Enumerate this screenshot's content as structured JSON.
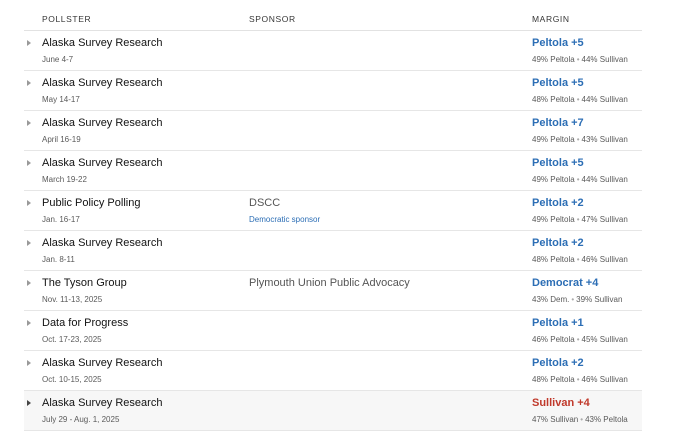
{
  "headers": {
    "pollster": "POLLSTER",
    "sponsor": "SPONSOR",
    "margin": "MARGIN"
  },
  "separator": "•",
  "colors": {
    "dem": "#2c6eb5",
    "rep": "#c0392b"
  },
  "polls": [
    {
      "pollster": "Alaska Survey Research",
      "dates": "June 4-7",
      "sponsor": "",
      "sponsor_note": "",
      "margin": "Peltola +5",
      "left": "49% Peltola",
      "right": "44% Sullivan"
    },
    {
      "pollster": "Alaska Survey Research",
      "dates": "May 14-17",
      "sponsor": "",
      "sponsor_note": "",
      "margin": "Peltola +5",
      "left": "48% Peltola",
      "right": "44% Sullivan"
    },
    {
      "pollster": "Alaska Survey Research",
      "dates": "April 16-19",
      "sponsor": "",
      "sponsor_note": "",
      "margin": "Peltola +7",
      "left": "49% Peltola",
      "right": "43% Sullivan"
    },
    {
      "pollster": "Alaska Survey Research",
      "dates": "March 19-22",
      "sponsor": "",
      "sponsor_note": "",
      "margin": "Peltola +5",
      "left": "49% Peltola",
      "right": "44% Sullivan"
    },
    {
      "pollster": "Public Policy Polling",
      "dates": "Jan. 16-17",
      "sponsor": "DSCC",
      "sponsor_note": "Democratic sponsor",
      "margin": "Peltola +2",
      "left": "49% Peltola",
      "right": "47% Sullivan"
    },
    {
      "pollster": "Alaska Survey Research",
      "dates": "Jan. 8-11",
      "sponsor": "",
      "sponsor_note": "",
      "margin": "Peltola +2",
      "left": "48% Peltola",
      "right": "46% Sullivan"
    },
    {
      "pollster": "The Tyson Group",
      "dates": "Nov. 11-13, 2025",
      "sponsor": "Plymouth Union Public Advocacy",
      "sponsor_note": "",
      "margin": "Democrat +4",
      "left": "43% Dem.",
      "right": "39% Sullivan"
    },
    {
      "pollster": "Data for Progress",
      "dates": "Oct. 17-23, 2025",
      "sponsor": "",
      "sponsor_note": "",
      "margin": "Peltola +1",
      "left": "46% Peltola",
      "right": "45% Sullivan"
    },
    {
      "pollster": "Alaska Survey Research",
      "dates": "Oct. 10-15, 2025",
      "sponsor": "",
      "sponsor_note": "",
      "margin": "Peltola +2",
      "left": "48% Peltola",
      "right": "46% Sullivan"
    },
    {
      "pollster": "Alaska Survey Research",
      "dates": "July 29 - Aug. 1, 2025",
      "sponsor": "",
      "sponsor_note": "",
      "margin": "Sullivan +4",
      "left": "47% Sullivan",
      "right": "43% Peltola",
      "leader": "rep"
    }
  ]
}
